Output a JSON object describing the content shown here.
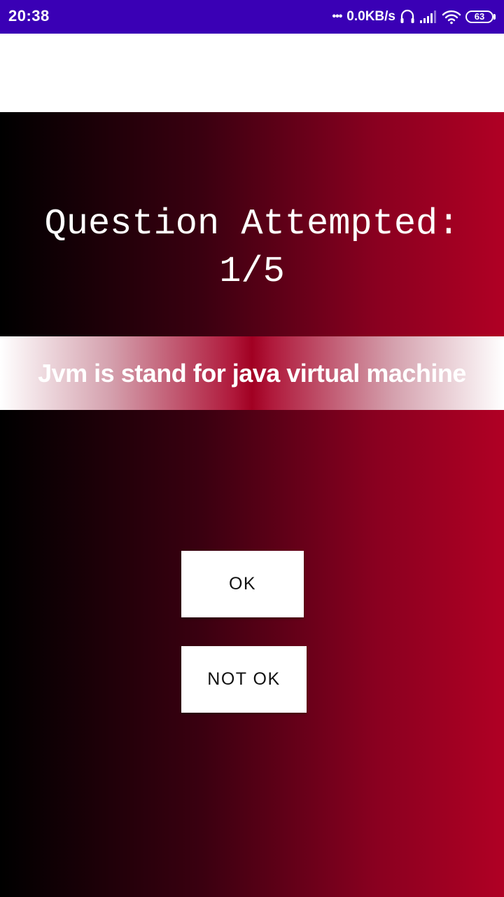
{
  "status_bar": {
    "time": "20:38",
    "network_speed": "0.0KB/s",
    "battery_level": "63",
    "bg_color": "#3a00b5",
    "icons": [
      "headset-icon",
      "signal-icon",
      "wifi-icon",
      "battery-icon"
    ]
  },
  "quiz": {
    "header_line1": "Question Attempted:",
    "header_line2": "1/5",
    "statement": "Jvm is stand for java virtual machine",
    "ok_label": "OK",
    "not_ok_label": "NOT OK"
  },
  "colors": {
    "gradient_start": "#000000",
    "gradient_end": "#b00024",
    "text": "#ffffff",
    "button_bg": "#ffffff"
  }
}
